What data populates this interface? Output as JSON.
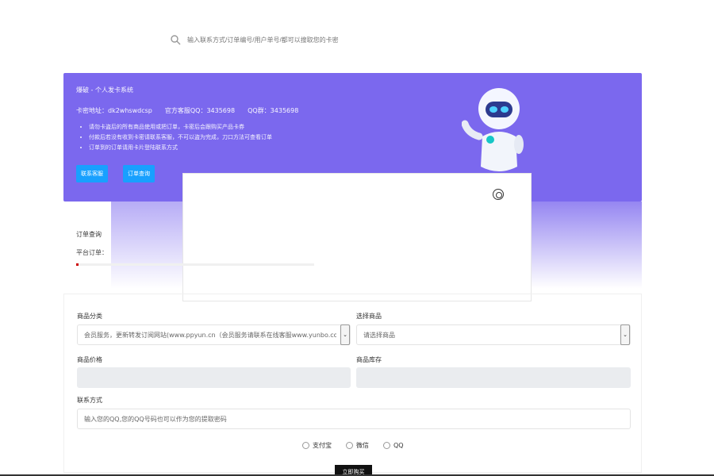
{
  "search": {
    "placeholder": "输入联系方式/订单编号/用户单号/都可以搜取您的卡密",
    "icon": "search-icon"
  },
  "banner": {
    "title": "爆破 - 个人发卡系统",
    "address": "卡密地址：dk2whswdcsp",
    "qq_group": "官方客服QQ：3435698",
    "qq_group2": "QQ群：3435698",
    "notes": [
      "  请勿卡盗后的所有商品使用或把订单，卡密后会跟购买产品卡券",
      "  付款后若没有收到卡密请联系客服，不可以盗为完成，刀口方法可查看订单",
      "  订单到的订单请用卡片登陆联系方式"
    ],
    "btn_contact": "联系客服",
    "btn_query": "订单查询",
    "bg_color": "#7b68ee"
  },
  "order": {
    "label": "订单查询",
    "sub": "平台订单：",
    "progress": 0.01
  },
  "form": {
    "category_label": "商品分类",
    "category_value": "会员服务，更新转发订阅网站(www.ppyun.cn（会员服务请联系在线客服www.yunbo.com）",
    "product_label": "选择商品",
    "product_value": "请选择商品",
    "price_label": "商品价格",
    "stock_label": "商品库存",
    "contact_label": "联系方式",
    "contact_placeholder": "输入您的QQ,您的QQ号码也可以作为您的提取密码",
    "radios": [
      "支付宝",
      "微信",
      "QQ"
    ],
    "buy_label": "立即购买"
  }
}
